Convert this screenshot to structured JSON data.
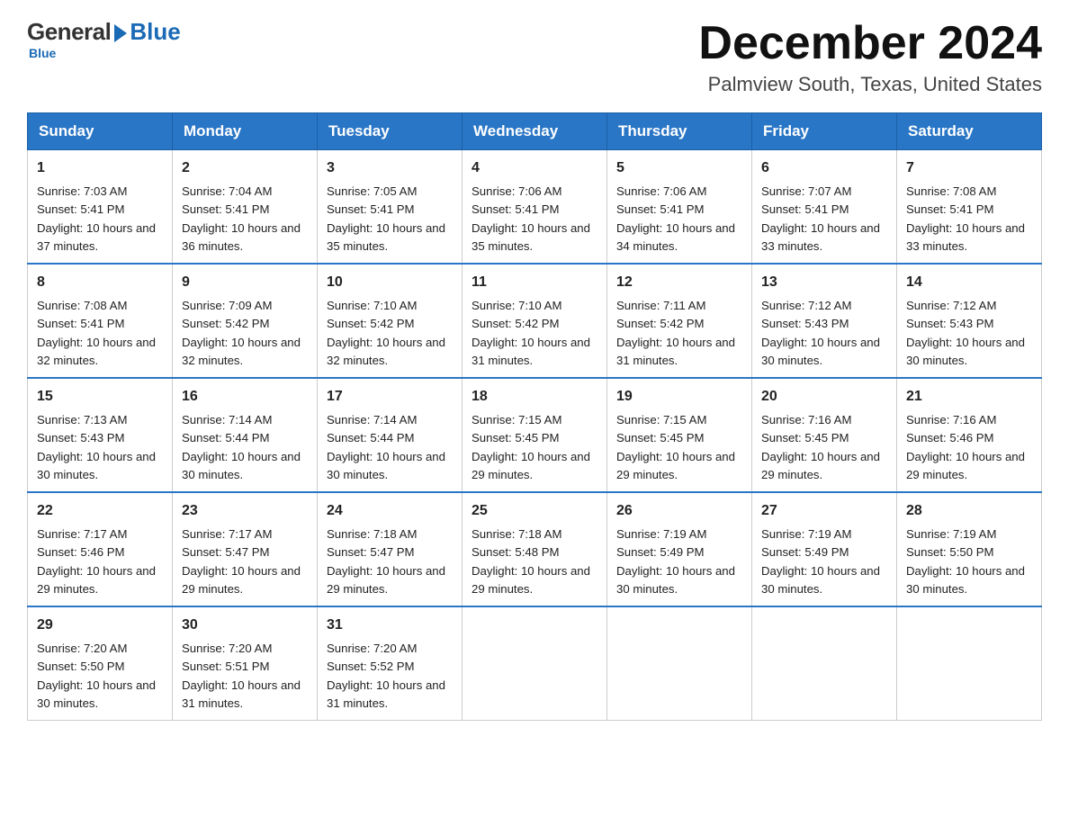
{
  "logo": {
    "general_text": "General",
    "blue_text": "Blue",
    "bottom_text": "Blue"
  },
  "header": {
    "month": "December 2024",
    "location": "Palmview South, Texas, United States"
  },
  "weekdays": [
    "Sunday",
    "Monday",
    "Tuesday",
    "Wednesday",
    "Thursday",
    "Friday",
    "Saturday"
  ],
  "weeks": [
    [
      {
        "day": "1",
        "sunrise": "7:03 AM",
        "sunset": "5:41 PM",
        "daylight": "10 hours and 37 minutes."
      },
      {
        "day": "2",
        "sunrise": "7:04 AM",
        "sunset": "5:41 PM",
        "daylight": "10 hours and 36 minutes."
      },
      {
        "day": "3",
        "sunrise": "7:05 AM",
        "sunset": "5:41 PM",
        "daylight": "10 hours and 35 minutes."
      },
      {
        "day": "4",
        "sunrise": "7:06 AM",
        "sunset": "5:41 PM",
        "daylight": "10 hours and 35 minutes."
      },
      {
        "day": "5",
        "sunrise": "7:06 AM",
        "sunset": "5:41 PM",
        "daylight": "10 hours and 34 minutes."
      },
      {
        "day": "6",
        "sunrise": "7:07 AM",
        "sunset": "5:41 PM",
        "daylight": "10 hours and 33 minutes."
      },
      {
        "day": "7",
        "sunrise": "7:08 AM",
        "sunset": "5:41 PM",
        "daylight": "10 hours and 33 minutes."
      }
    ],
    [
      {
        "day": "8",
        "sunrise": "7:08 AM",
        "sunset": "5:41 PM",
        "daylight": "10 hours and 32 minutes."
      },
      {
        "day": "9",
        "sunrise": "7:09 AM",
        "sunset": "5:42 PM",
        "daylight": "10 hours and 32 minutes."
      },
      {
        "day": "10",
        "sunrise": "7:10 AM",
        "sunset": "5:42 PM",
        "daylight": "10 hours and 32 minutes."
      },
      {
        "day": "11",
        "sunrise": "7:10 AM",
        "sunset": "5:42 PM",
        "daylight": "10 hours and 31 minutes."
      },
      {
        "day": "12",
        "sunrise": "7:11 AM",
        "sunset": "5:42 PM",
        "daylight": "10 hours and 31 minutes."
      },
      {
        "day": "13",
        "sunrise": "7:12 AM",
        "sunset": "5:43 PM",
        "daylight": "10 hours and 30 minutes."
      },
      {
        "day": "14",
        "sunrise": "7:12 AM",
        "sunset": "5:43 PM",
        "daylight": "10 hours and 30 minutes."
      }
    ],
    [
      {
        "day": "15",
        "sunrise": "7:13 AM",
        "sunset": "5:43 PM",
        "daylight": "10 hours and 30 minutes."
      },
      {
        "day": "16",
        "sunrise": "7:14 AM",
        "sunset": "5:44 PM",
        "daylight": "10 hours and 30 minutes."
      },
      {
        "day": "17",
        "sunrise": "7:14 AM",
        "sunset": "5:44 PM",
        "daylight": "10 hours and 30 minutes."
      },
      {
        "day": "18",
        "sunrise": "7:15 AM",
        "sunset": "5:45 PM",
        "daylight": "10 hours and 29 minutes."
      },
      {
        "day": "19",
        "sunrise": "7:15 AM",
        "sunset": "5:45 PM",
        "daylight": "10 hours and 29 minutes."
      },
      {
        "day": "20",
        "sunrise": "7:16 AM",
        "sunset": "5:45 PM",
        "daylight": "10 hours and 29 minutes."
      },
      {
        "day": "21",
        "sunrise": "7:16 AM",
        "sunset": "5:46 PM",
        "daylight": "10 hours and 29 minutes."
      }
    ],
    [
      {
        "day": "22",
        "sunrise": "7:17 AM",
        "sunset": "5:46 PM",
        "daylight": "10 hours and 29 minutes."
      },
      {
        "day": "23",
        "sunrise": "7:17 AM",
        "sunset": "5:47 PM",
        "daylight": "10 hours and 29 minutes."
      },
      {
        "day": "24",
        "sunrise": "7:18 AM",
        "sunset": "5:47 PM",
        "daylight": "10 hours and 29 minutes."
      },
      {
        "day": "25",
        "sunrise": "7:18 AM",
        "sunset": "5:48 PM",
        "daylight": "10 hours and 29 minutes."
      },
      {
        "day": "26",
        "sunrise": "7:19 AM",
        "sunset": "5:49 PM",
        "daylight": "10 hours and 30 minutes."
      },
      {
        "day": "27",
        "sunrise": "7:19 AM",
        "sunset": "5:49 PM",
        "daylight": "10 hours and 30 minutes."
      },
      {
        "day": "28",
        "sunrise": "7:19 AM",
        "sunset": "5:50 PM",
        "daylight": "10 hours and 30 minutes."
      }
    ],
    [
      {
        "day": "29",
        "sunrise": "7:20 AM",
        "sunset": "5:50 PM",
        "daylight": "10 hours and 30 minutes."
      },
      {
        "day": "30",
        "sunrise": "7:20 AM",
        "sunset": "5:51 PM",
        "daylight": "10 hours and 31 minutes."
      },
      {
        "day": "31",
        "sunrise": "7:20 AM",
        "sunset": "5:52 PM",
        "daylight": "10 hours and 31 minutes."
      },
      null,
      null,
      null,
      null
    ]
  ],
  "labels": {
    "sunrise": "Sunrise:",
    "sunset": "Sunset:",
    "daylight": "Daylight:"
  }
}
